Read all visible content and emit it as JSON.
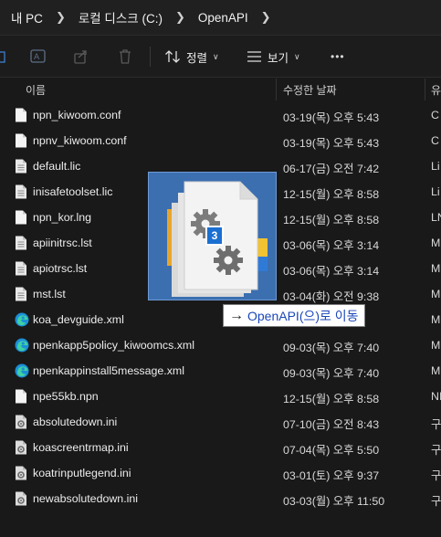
{
  "breadcrumb": {
    "items": [
      "내 PC",
      "로컬 디스크 (C:)",
      "OpenAPI"
    ]
  },
  "toolbar": {
    "sort_label": "정렬",
    "view_label": "보기",
    "more_label": "•••"
  },
  "columns": {
    "name": "이름",
    "modified": "수정한 날짜",
    "type": "유"
  },
  "files": [
    {
      "name": "npn_kiwoom.conf",
      "date": "03-19(목) 오후 5:43",
      "type": "C",
      "icon": "doc"
    },
    {
      "name": "npnv_kiwoom.conf",
      "date": "03-19(목) 오후 5:43",
      "type": "C",
      "icon": "doc"
    },
    {
      "name": "default.lic",
      "date": "06-17(금) 오전 7:42",
      "type": "Li",
      "icon": "doc-lines"
    },
    {
      "name": "inisafetoolset.lic",
      "date": "12-15(월) 오후 8:58",
      "type": "Li",
      "icon": "doc-lines"
    },
    {
      "name": "npn_kor.lng",
      "date": "12-15(월) 오후 8:58",
      "type": "LN",
      "icon": "doc"
    },
    {
      "name": "apiinitrsc.lst",
      "date": "03-06(목) 오후 3:14",
      "type": "M",
      "icon": "doc-lines"
    },
    {
      "name": "apiotrsc.lst",
      "date": "03-06(목) 오후 3:14",
      "type": "M",
      "icon": "doc-lines"
    },
    {
      "name": "mst.lst",
      "date": "03-04(화) 오전 9:38",
      "type": "M",
      "icon": "doc-lines"
    },
    {
      "name": "koa_devguide.xml",
      "date": "",
      "type": "M",
      "icon": "edge"
    },
    {
      "name": "npenkapp5policy_kiwoomcs.xml",
      "date": "09-03(목) 오후 7:40",
      "type": "M",
      "icon": "edge"
    },
    {
      "name": "npenkappinstall5message.xml",
      "date": "09-03(목) 오후 7:40",
      "type": "M",
      "icon": "edge"
    },
    {
      "name": "npe55kb.npn",
      "date": "12-15(월) 오후 8:58",
      "type": "NI",
      "icon": "doc"
    },
    {
      "name": "absolutedown.ini",
      "date": "07-10(금) 오전 8:43",
      "type": "구",
      "icon": "ini"
    },
    {
      "name": "koascreentrmap.ini",
      "date": "07-04(목) 오후 5:50",
      "type": "구",
      "icon": "ini"
    },
    {
      "name": "koatrinputlegend.ini",
      "date": "03-01(토) 오후 9:37",
      "type": "구",
      "icon": "ini"
    },
    {
      "name": "newabsolutedown.ini",
      "date": "03-03(월) 오후 11:50",
      "type": "구",
      "icon": "ini"
    }
  ],
  "drag": {
    "badge_count": "3",
    "tip_arrow": "→",
    "tip_text": "OpenAPI(으)로 이동"
  }
}
